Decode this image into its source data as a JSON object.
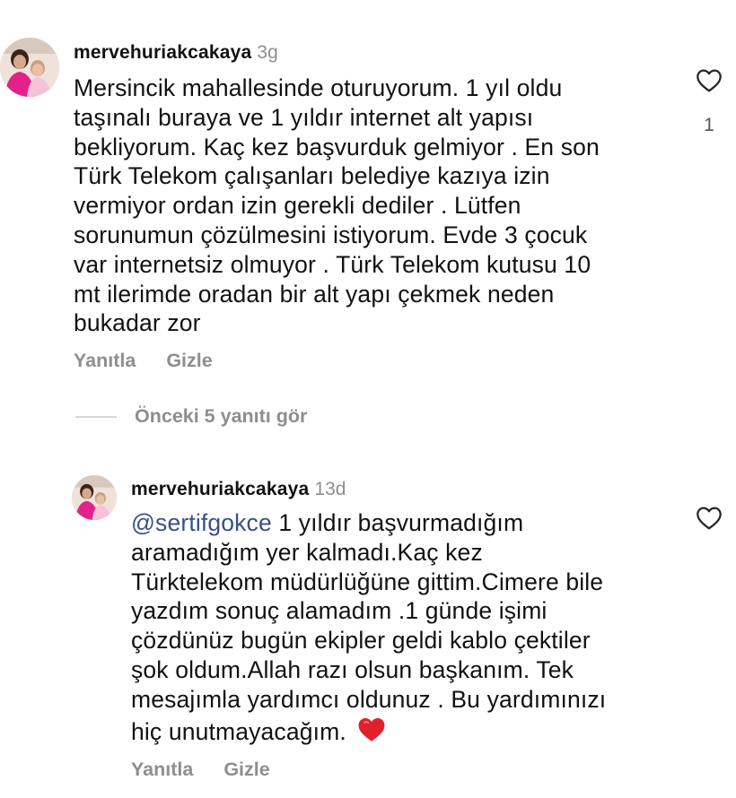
{
  "comments": [
    {
      "username": "mervehuriakcakaya",
      "time": "3g",
      "lines": [
        "Mersincik mahallesinde oturuyorum. 1 yıl oldu",
        "taşınalı buraya ve 1 yıldır internet alt yapısı",
        "bekliyorum. Kaç kez başvurduk gelmiyor . En son",
        "Türk Telekom çalışanları belediye kazıya izin",
        "vermiyor ordan izin gerekli dediler . Lütfen",
        "sorunumun çözülmesini istiyorum. Evde 3 çocuk",
        "var internetsiz olmuyor . Türk Telekom kutusu 10",
        "mt ilerimde oradan bir alt yapı çekmek neden",
        "bukadar zor"
      ],
      "reply_label": "Yanıtla",
      "hide_label": "Gizle",
      "like_count": "1"
    }
  ],
  "view_replies_label": "Önceki 5 yanıtı gör",
  "reply": {
    "username": "mervehuriakcakaya",
    "time": "13d",
    "mention": "@sertifgokce",
    "first_line_rest": " 1 yıldır başvurmadığım",
    "lines": [
      "aramadığım yer kalmadı.Kaç kez",
      "Türktelekom müdürlüğüne gittim.Cimere bile",
      "yazdım sonuç alamadım .1 günde işimi",
      "çözdünüz bugün ekipler geldi kablo çektiler",
      "şok oldum.Allah razı olsun başkanım. Tek",
      "mesajımla yardımcı oldunuz . Bu yardımınızı"
    ],
    "last_line": "hiç unutmayacağım.",
    "reply_label": "Yanıtla",
    "hide_label": "Gizle"
  },
  "colors": {
    "mention": "#385185",
    "muted": "#8e8e8e",
    "heart_red": "#e0202b"
  },
  "icons": {
    "like": "heart-outline-icon",
    "emoji": "red-heart-emoji"
  }
}
